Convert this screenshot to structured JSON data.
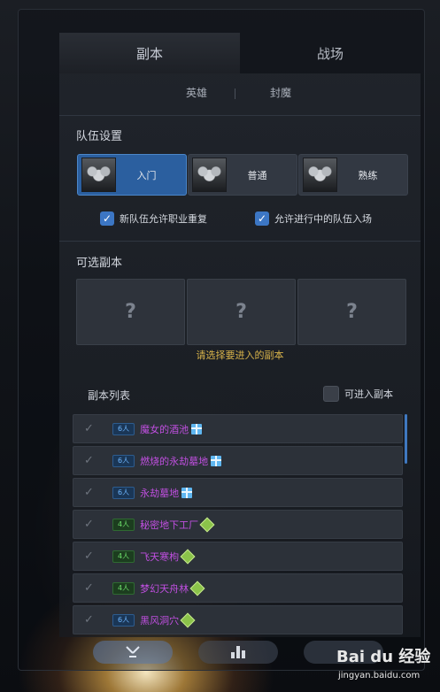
{
  "tabs": {
    "dungeon": "副本",
    "battlefield": "战场"
  },
  "subtabs": {
    "hero": "英雄",
    "seal": "封魔"
  },
  "team_settings": {
    "title": "队伍设置",
    "difficulties": [
      {
        "label": "入门",
        "active": true
      },
      {
        "label": "普通",
        "active": false
      },
      {
        "label": "熟练",
        "active": false
      }
    ],
    "options": {
      "allow_duplicate": "新队伍允许职业重复",
      "allow_join_in_progress": "允许进行中的队伍入场"
    }
  },
  "available": {
    "title": "可选副本",
    "slot_placeholder": "?",
    "hint": "请选择要进入的副本"
  },
  "dungeon_list": {
    "title": "副本列表",
    "enterable_label": "可进入副本",
    "rows": [
      {
        "size": "6人",
        "name": "魔女的酒池",
        "icon": "gift-icon"
      },
      {
        "size": "6人",
        "name": "燃烧的永劫墓地",
        "icon": "gift-icon"
      },
      {
        "size": "6人",
        "name": "永劫墓地",
        "icon": "gift-icon"
      },
      {
        "size": "4人",
        "name": "秘密地下工厂",
        "icon": "diamond-icon"
      },
      {
        "size": "4人",
        "name": "飞天寒枸",
        "icon": "diamond-icon"
      },
      {
        "size": "4人",
        "name": "梦幻天舟林",
        "icon": "diamond-icon"
      },
      {
        "size": "6人",
        "name": "黑风洞穴",
        "icon": "diamond-icon"
      }
    ]
  },
  "watermark": {
    "brand": "Bai du 经验",
    "url": "jingyan.baidu.com"
  },
  "colors": {
    "accent_blue": "#2b5f9f",
    "dungeon_name": "#c04fe0",
    "hint_gold": "#d7b24a"
  }
}
